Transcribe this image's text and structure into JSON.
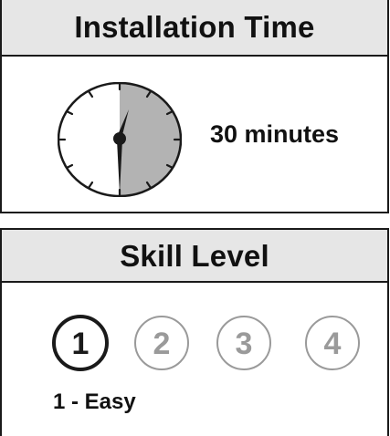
{
  "installation": {
    "title": "Installation Time",
    "duration": "30 minutes",
    "clock_fill_fraction": 0.5
  },
  "skill": {
    "title": "Skill Level",
    "levels": [
      "1",
      "2",
      "3",
      "4"
    ],
    "selected_level": 1,
    "caption": "1 - Easy"
  },
  "colors": {
    "header_bg": "#e6e6e6",
    "clock_fill": "#b3b3b3",
    "active_circle": "#1a1a1a",
    "inactive_circle": "#9a9a9a"
  }
}
